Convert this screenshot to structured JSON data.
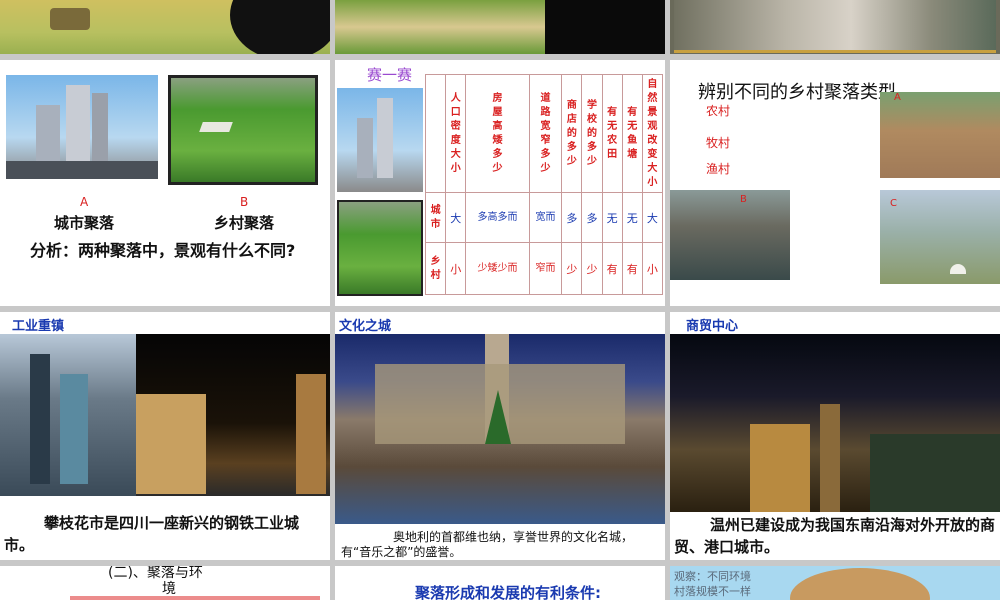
{
  "slide5": {
    "title": "赛一赛",
    "headers": [
      "人口密度大小",
      "房屋高矮多少",
      "道路宽窄多少",
      "商店的多少",
      "学校的多少",
      "有无农田",
      "有无鱼塘",
      "自然景观改变大小"
    ],
    "row_city_label": "城市",
    "row_city": [
      "大",
      "多高多而",
      "宽而",
      "多",
      "多",
      "无",
      "无",
      "大"
    ],
    "row_village_label": "乡村",
    "row_village": [
      "小",
      "少矮少而",
      "窄而",
      "少",
      "少",
      "有",
      "有",
      "小"
    ]
  },
  "slide4": {
    "label_a": "A",
    "label_b": "B",
    "caption_a": "城市聚落",
    "caption_b": "乡村聚落",
    "question": "分析：两种聚落中，景观有什么不同?"
  },
  "slide6": {
    "title": "辨别不同的乡村聚落类型",
    "items": [
      "农村",
      "牧村",
      "渔村"
    ],
    "label_a": "A",
    "label_b": "B",
    "label_c": "C"
  },
  "slide7": {
    "label": "工业重镇",
    "text": "攀枝花市是四川一座新兴的钢铁工业城市。"
  },
  "slide8": {
    "label": "文化之城",
    "text_line1": "奥地利的首都维也纳，享誉世界的文化名城，",
    "text_line2": "有“音乐之都”的盛誉。"
  },
  "slide9": {
    "label": "商贸中心",
    "text": "温州已建设成为我国东南沿海对外开放的商贸、港口城市。"
  },
  "slide10": {
    "line1": "(二)、聚落与环",
    "line2": "境"
  },
  "slide11": {
    "text": "聚落形成和发展的有利条件:"
  },
  "slide12": {
    "line1": "观察：不同环境",
    "line2": "村落规模不一样"
  }
}
